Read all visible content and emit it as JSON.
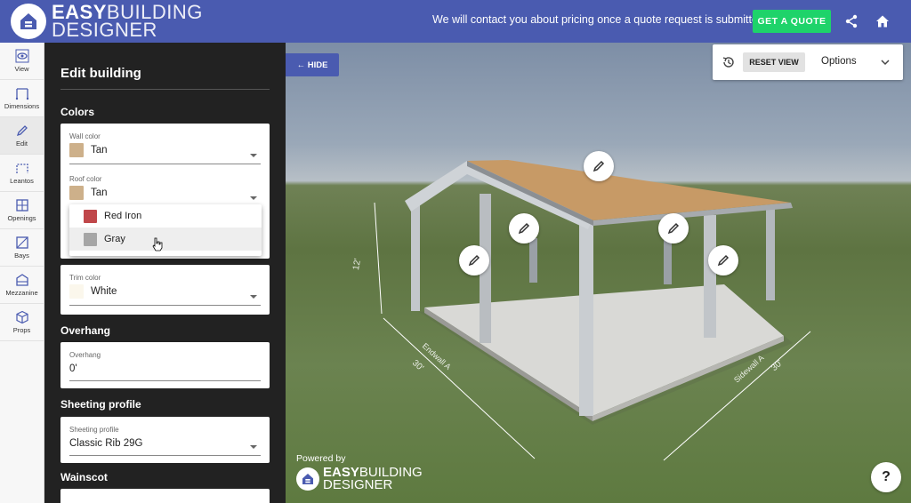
{
  "header": {
    "logo_word_1": "EASY",
    "logo_word_2": "BUILDING",
    "logo_word_3": "DESIGNER",
    "message": "We will contact you about pricing once a quote request is submitted",
    "quote_button": "GET A QUOTE",
    "icons": [
      "share-icon",
      "home-icon"
    ]
  },
  "nav": {
    "items": [
      {
        "label": "View",
        "icon": "eye-icon"
      },
      {
        "label": "Dimensions",
        "icon": "dimensions-icon"
      },
      {
        "label": "Edit",
        "icon": "pencil-icon",
        "active": true
      },
      {
        "label": "Leantos",
        "icon": "leanto-icon"
      },
      {
        "label": "Openings",
        "icon": "window-icon"
      },
      {
        "label": "Bays",
        "icon": "bays-icon"
      },
      {
        "label": "Mezzanine",
        "icon": "mezzanine-icon"
      },
      {
        "label": "Props",
        "icon": "cube-icon"
      }
    ]
  },
  "panel": {
    "title": "Edit building",
    "colors_heading": "Colors",
    "wall_color_label": "Wall color",
    "wall_color_value": "Tan",
    "roof_color_label": "Roof color",
    "roof_color_value": "Tan",
    "dropdown_options": [
      {
        "label": "Red Iron",
        "color": "#c0474a"
      },
      {
        "label": "Gray",
        "color": "#a6a6a6"
      }
    ],
    "trim_color_label": "Trim color",
    "trim_color_value": "White",
    "overhang_heading": "Overhang",
    "overhang_label": "Overhang",
    "overhang_value": "0'",
    "sheeting_heading": "Sheeting profile",
    "sheeting_label": "Sheeting profile",
    "sheeting_value": "Classic Rib 29G",
    "wainscot_heading": "Wainscot"
  },
  "colors": {
    "tan": "#cdb08a",
    "white": "#fbf7ec",
    "brand": "#4a5bb0",
    "accent": "#1ed36a"
  },
  "scene": {
    "hide_button": "← HIDE",
    "reset_view": "RESET VIEW",
    "options": "Options",
    "powered_by": "Powered by",
    "help": "?",
    "dim_height": "12'",
    "dim_width_left": "30'",
    "dim_width_right": "30'",
    "endwall_label": "Endwall A",
    "sidewall_label": "Sidewall A"
  }
}
